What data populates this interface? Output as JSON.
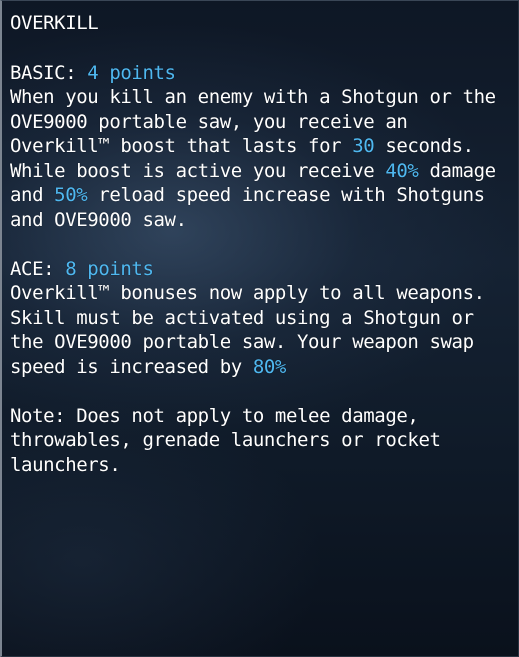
{
  "skill": {
    "title": "OVERKILL",
    "basic": {
      "label": "BASIC:",
      "cost": "4 points",
      "desc_1": "When you kill an enemy with a Shotgun or the OVE9000 portable saw, you receive an Overkill™ boost that lasts for ",
      "duration": "30",
      "desc_2": " seconds. While boost is active you receive ",
      "damage": "40%",
      "desc_3": " damage and ",
      "reload": "50%",
      "desc_4": " reload speed increase with Shotguns and OVE9000 saw."
    },
    "ace": {
      "label": "ACE:",
      "cost": "8 points",
      "desc_1": "Overkill™  bonuses now apply to all weapons. Skill must be activated using a Shotgun or the OVE9000 portable saw. Your weapon swap speed is increased by ",
      "swap": "80%"
    },
    "note": "Note: Does not apply to melee damage, throwables, grenade launchers or rocket launchers."
  },
  "colors": {
    "highlight": "#4fb8f0",
    "text": "#ffffff",
    "background": "#152233"
  }
}
